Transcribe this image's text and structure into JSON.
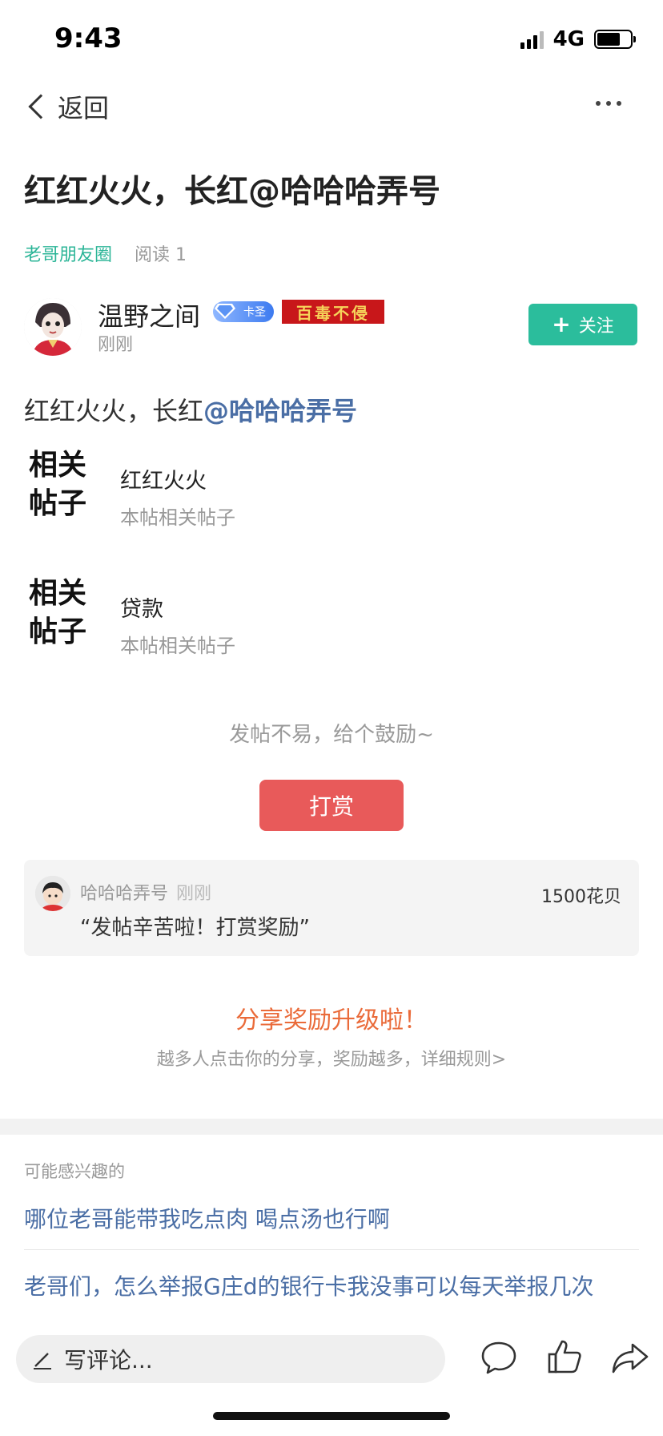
{
  "status_bar": {
    "time": "9:43",
    "network": "4G"
  },
  "nav": {
    "back_label": "返回",
    "more_icon": "more-dots-icon"
  },
  "post": {
    "title": "红红火火，长红@哈哈哈弄号",
    "circle": "老哥朋友圈",
    "read_count": "阅读 1",
    "author": {
      "name": "温野之间",
      "level_badge": "卡圣",
      "title_badge": "百毒不侵",
      "time": "刚刚",
      "follow_label": "关注"
    },
    "body_prefix": "红红火火，长红",
    "body_mention": "@哈哈哈弄号",
    "related": [
      {
        "badge_line1": "相关",
        "badge_line2": "帖子",
        "title": "红红火火",
        "subtitle": "本帖相关帖子"
      },
      {
        "badge_line1": "相关",
        "badge_line2": "帖子",
        "title": "贷款",
        "subtitle": "本帖相关帖子"
      }
    ]
  },
  "reward": {
    "encourage_text": "发帖不易，给个鼓励~",
    "button_label": "打赏",
    "tip": {
      "user": "哈哈哈弄号",
      "time": "刚刚",
      "amount": "1500花贝",
      "message": "“发帖辛苦啦！打赏奖励”"
    }
  },
  "share": {
    "title": "分享奖励升级啦！",
    "subtitle": "越多人点击你的分享，奖励越多，详细规则>"
  },
  "recommend": {
    "label": "可能感兴趣的",
    "items": [
      "哪位老哥能带我吃点肉 喝点汤也行啊",
      "老哥们，怎么举报G庄d的银行卡我没事可以每天举报几次"
    ]
  },
  "bottom_bar": {
    "comment_placeholder": "写评论...",
    "icons": [
      "comment-icon",
      "like-icon",
      "share-icon"
    ]
  },
  "colors": {
    "accent_green": "#2bbd9c",
    "reward_red": "#e85a5a",
    "share_orange": "#ea6b3a",
    "link_blue": "#4a6ea5"
  }
}
